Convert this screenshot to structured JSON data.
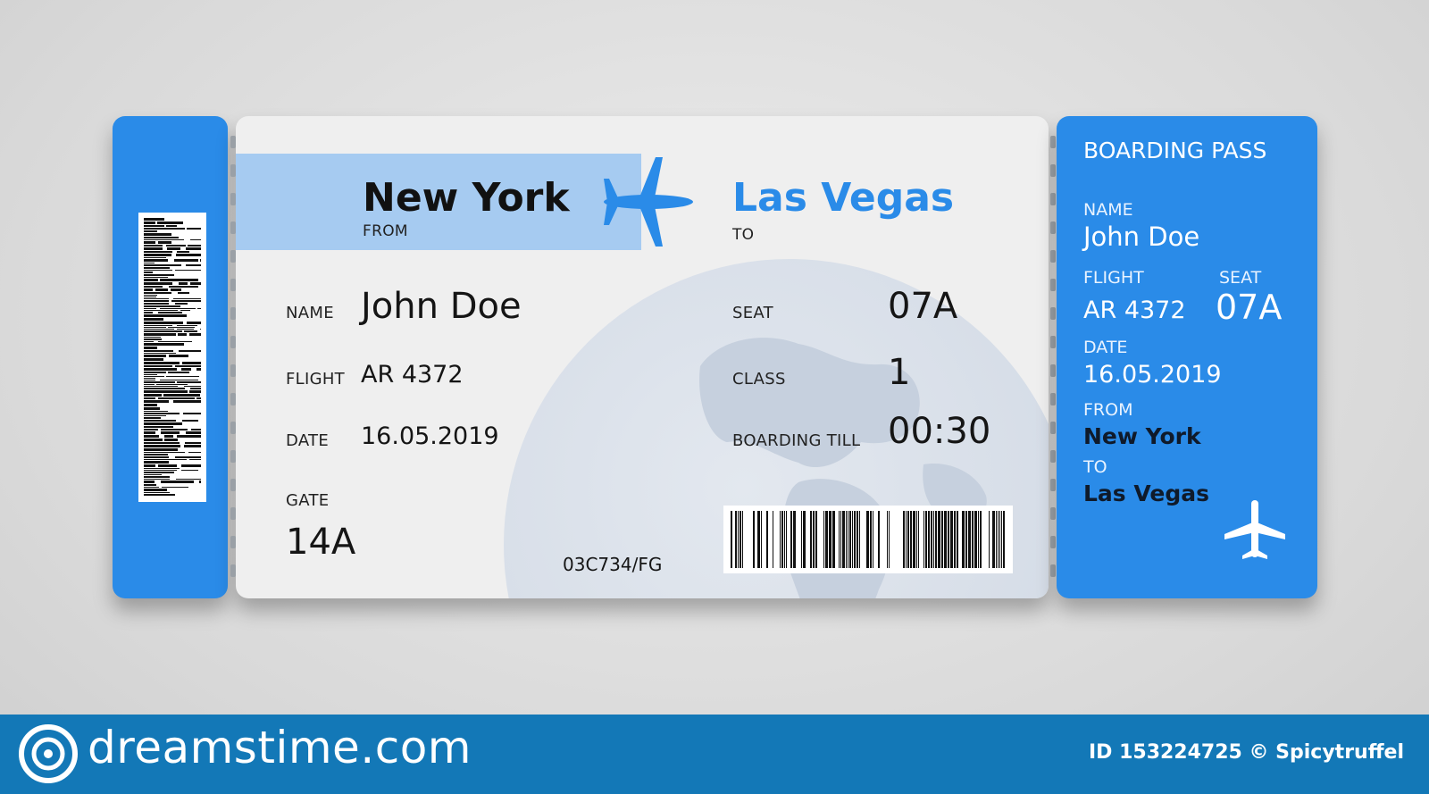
{
  "left_stub": {},
  "main": {
    "from_city": "New York",
    "from_label": "FROM",
    "to_city": "Las Vegas",
    "to_label": "TO",
    "name_label": "NAME",
    "name_value": "John Doe",
    "flight_label": "FLIGHT",
    "flight_value": "AR 4372",
    "date_label": "DATE",
    "date_value": "16.05.2019",
    "gate_label": "GATE",
    "gate_value": "14A",
    "seat_label": "SEAT",
    "seat_value": "07A",
    "class_label": "CLASS",
    "class_value": "1",
    "boarding_label": "BOARDING TILL",
    "boarding_value": "00:30",
    "code": "03C734/FG"
  },
  "stub": {
    "title": "BOARDING PASS",
    "name_label": "NAME",
    "name_value": "John Doe",
    "flight_label": "FLIGHT",
    "flight_value": "AR 4372",
    "seat_label": "SEAT",
    "seat_value": "07A",
    "date_label": "DATE",
    "date_value": "16.05.2019",
    "from_label": "FROM",
    "from_value": "New York",
    "to_label": "TO",
    "to_value": "Las Vegas"
  },
  "watermark": {
    "brand": "dreamstime.com",
    "id_text": "ID 153224725 © Spicytruffel"
  },
  "colors": {
    "accent_blue": "#2a8be8",
    "band_blue": "#a6cbf1",
    "footer_blue": "#1378b7"
  },
  "icons": [
    "airplane-icon",
    "barcode",
    "globe",
    "dreamstime-logo"
  ]
}
